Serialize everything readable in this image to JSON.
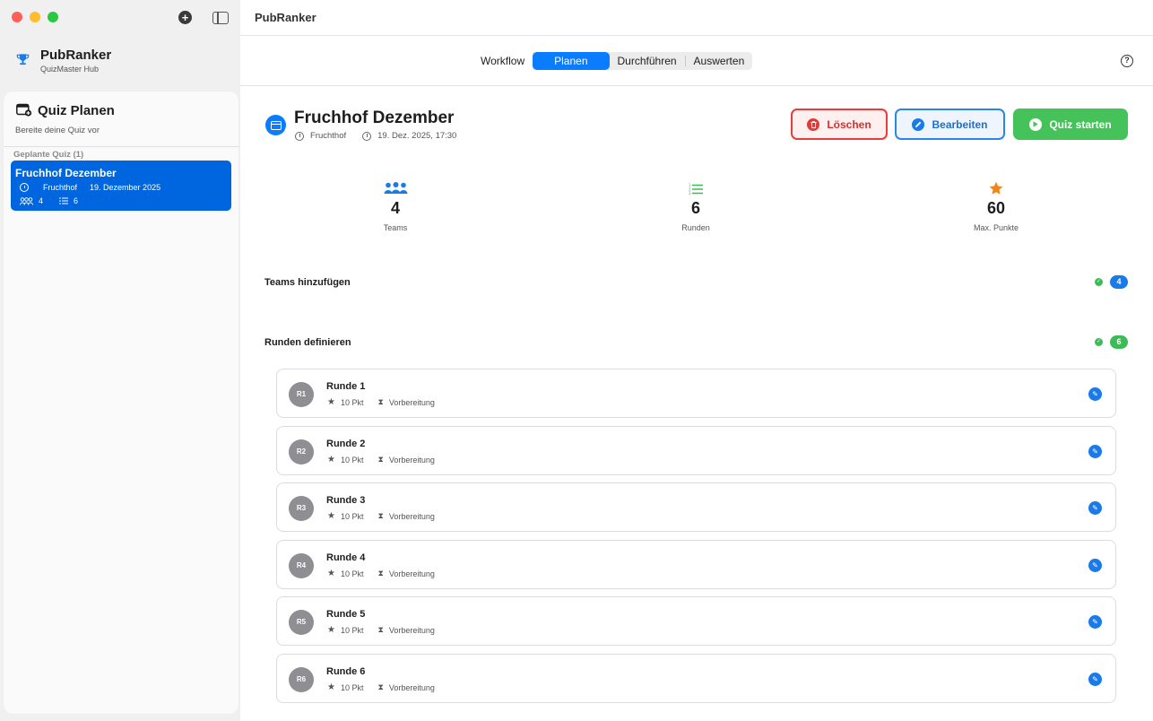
{
  "window": {
    "title": "PubRanker"
  },
  "brand": {
    "name": "PubRanker",
    "subtitle": "QuizMaster Hub"
  },
  "workflow": {
    "label": "Workflow",
    "tabs": [
      {
        "label": "Planen",
        "active": true
      },
      {
        "label": "Durchführen",
        "active": false
      },
      {
        "label": "Auswerten",
        "active": false
      }
    ]
  },
  "sidebar": {
    "title": "Quiz Planen",
    "subtitle": "Bereite deine Quiz vor",
    "section": "Geplante Quiz (1)",
    "quizzes": [
      {
        "title": "Fruchhof Dezember",
        "venue": "Fruchthof",
        "date": "19. Dezember 2025",
        "teams": "4",
        "rounds": "6"
      }
    ]
  },
  "detail": {
    "title": "Fruchhof Dezember",
    "venue": "Fruchthof",
    "datetime": "19. Dez. 2025, 17:30",
    "buttons": {
      "delete": "Löschen",
      "edit": "Bearbeiten",
      "start": "Quiz starten"
    },
    "stats": [
      {
        "icon": "people-icon",
        "value": "4",
        "label": "Teams",
        "color": "#1a7ae6"
      },
      {
        "icon": "list-icon",
        "value": "6",
        "label": "Runden",
        "color": "#3dbb56"
      },
      {
        "icon": "star-icon",
        "value": "60",
        "label": "Max. Punkte",
        "color": "#f0851a"
      }
    ],
    "teams_section": {
      "title": "Teams hinzufügen",
      "count": "4",
      "badge_color": "#1a7ae6"
    },
    "rounds_section": {
      "title": "Runden definieren",
      "count": "6",
      "badge_color": "#3dbb56"
    },
    "rounds": [
      {
        "badge": "R1",
        "name": "Runde 1",
        "points": "10 Pkt",
        "status": "Vorbereitung"
      },
      {
        "badge": "R2",
        "name": "Runde 2",
        "points": "10 Pkt",
        "status": "Vorbereitung"
      },
      {
        "badge": "R3",
        "name": "Runde 3",
        "points": "10 Pkt",
        "status": "Vorbereitung"
      },
      {
        "badge": "R4",
        "name": "Runde 4",
        "points": "10 Pkt",
        "status": "Vorbereitung"
      },
      {
        "badge": "R5",
        "name": "Runde 5",
        "points": "10 Pkt",
        "status": "Vorbereitung"
      },
      {
        "badge": "R6",
        "name": "Runde 6",
        "points": "10 Pkt",
        "status": "Vorbereitung"
      }
    ]
  }
}
